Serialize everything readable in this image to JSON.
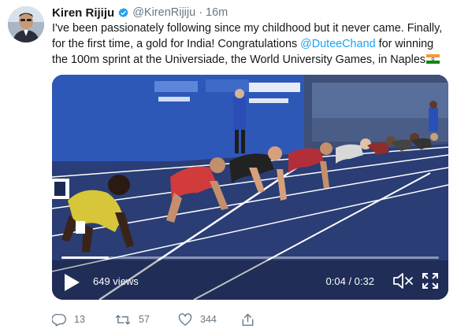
{
  "tweet": {
    "author_name": "Kiren Rijiju",
    "handle": "@KirenRijiju",
    "separator": "·",
    "time": "16m",
    "text_before": "I've been passionately following since my childhood but it never came. Finally, for the first time, a gold for India! Congratulations ",
    "mention": "@DuteeChand",
    "text_after": " for winning the 100m sprint at the Universiade, the World University Games, in Naples"
  },
  "video": {
    "views": "649 views",
    "time_display": "0:04 / 0:32",
    "progress": 0.125
  },
  "actions": {
    "replies": "13",
    "retweets": "57",
    "likes": "344"
  },
  "colors": {
    "link": "#1da1f2",
    "muted": "#657786",
    "verified": "#1da1f2"
  },
  "icons": [
    "verified-badge-icon",
    "india-flag-icon",
    "play-icon",
    "mute-icon",
    "fullscreen-icon",
    "reply-icon",
    "retweet-icon",
    "like-icon",
    "share-icon"
  ]
}
